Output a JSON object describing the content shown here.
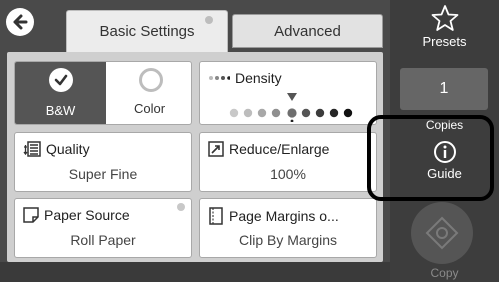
{
  "tabs": {
    "basic": "Basic Settings",
    "advanced": "Advanced"
  },
  "color_mode": {
    "bw_label": "B&W",
    "color_label": "Color",
    "selected": "B&W"
  },
  "density": {
    "label": "Density",
    "level_fraction": 0.5
  },
  "quality": {
    "label": "Quality",
    "value": "Super Fine"
  },
  "reduce_enlarge": {
    "label": "Reduce/Enlarge",
    "value": "100%"
  },
  "paper_source": {
    "label": "Paper Source",
    "value": "Roll Paper"
  },
  "page_margins": {
    "label": "Page Margins o...",
    "value": "Clip By Margins"
  },
  "sidebar": {
    "presets_label": "Presets",
    "copies_value": "1",
    "copies_label": "Copies",
    "guide_label": "Guide",
    "copy_label": "Copy"
  },
  "colors": {
    "panel_bg": "#4a4a4a",
    "sidebar_bg": "#3d3d3d",
    "selected_bg": "#555555"
  }
}
